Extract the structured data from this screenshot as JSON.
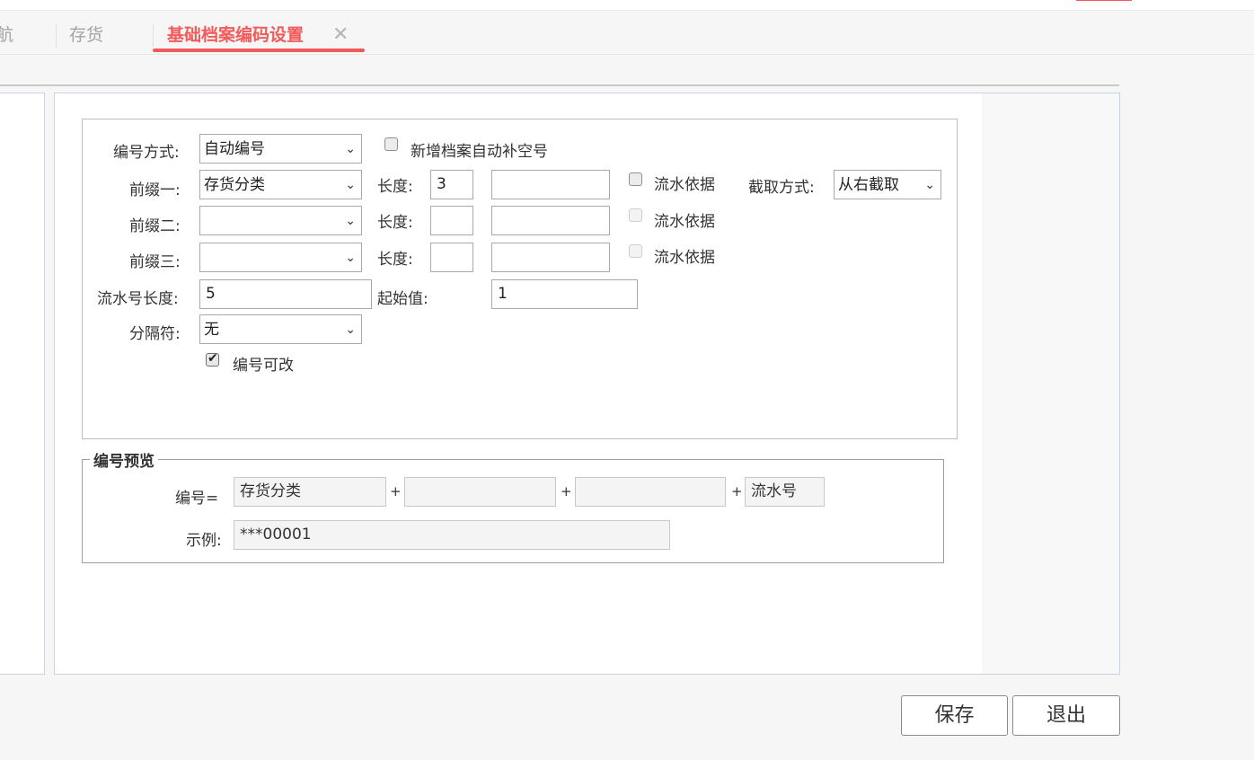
{
  "tabs": [
    {
      "label": "航",
      "active": false
    },
    {
      "label": "存货",
      "active": false
    },
    {
      "label": "基础档案编码设置",
      "active": true
    }
  ],
  "tab_close_symbol": "✕",
  "form": {
    "numbering_mode": {
      "label": "编号方式:",
      "value": "自动编号"
    },
    "auto_fill_blank": {
      "label": "新增档案自动补空号",
      "checked": false
    },
    "prefix1": {
      "label": "前缀一:",
      "value": "存货分类",
      "length_label": "长度:",
      "length": "3",
      "extra": "",
      "serial_basis_label": "流水依据",
      "serial_basis_checked": false
    },
    "cut_mode": {
      "label": "截取方式:",
      "value": "从右截取"
    },
    "prefix2": {
      "label": "前缀二:",
      "value": "",
      "length_label": "长度:",
      "length": "",
      "extra": "",
      "serial_basis_label": "流水依据"
    },
    "prefix3": {
      "label": "前缀三:",
      "value": "",
      "length_label": "长度:",
      "length": "",
      "extra": "",
      "serial_basis_label": "流水依据"
    },
    "serial_length": {
      "label": "流水号长度:",
      "value": "5"
    },
    "start_value": {
      "label": "起始值:",
      "value": "1"
    },
    "separator": {
      "label": "分隔符:",
      "value": "无"
    },
    "editable": {
      "label": "编号可改",
      "checked": true
    }
  },
  "preview": {
    "legend": "编号预览",
    "code_label": "编号=",
    "parts": [
      "存货分类",
      "",
      "",
      "流水号"
    ],
    "plus": "+",
    "example_label": "示例:",
    "example_value": "***00001"
  },
  "buttons": {
    "save": "保存",
    "exit": "退出"
  }
}
